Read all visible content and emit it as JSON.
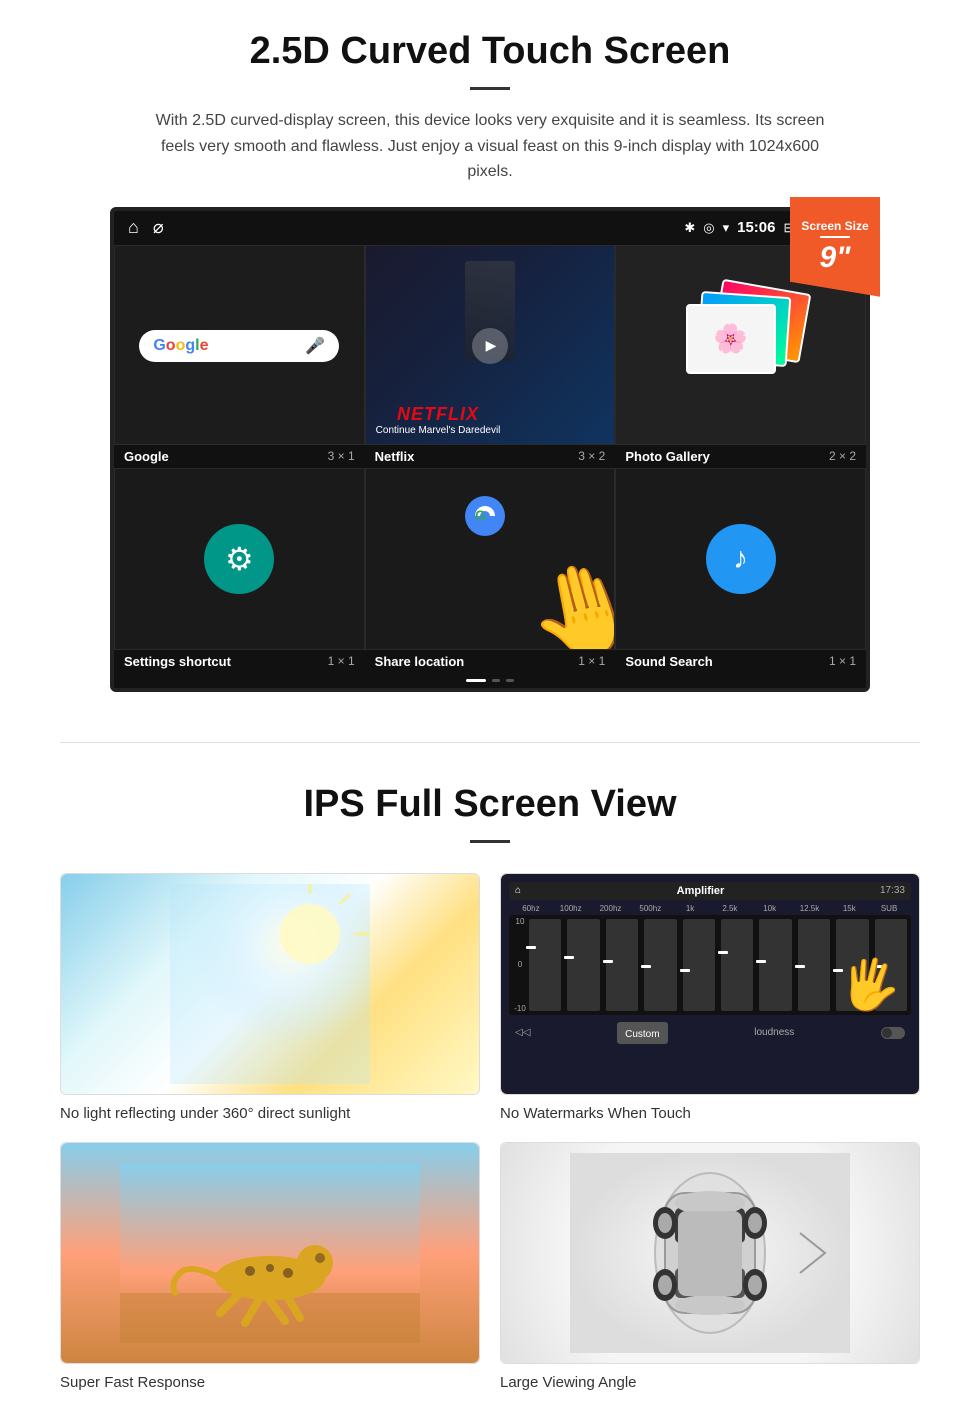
{
  "section1": {
    "title": "2.5D Curved Touch Screen",
    "description": "With 2.5D curved-display screen, this device looks very exquisite and it is seamless. Its screen feels very smooth and flawless. Just enjoy a visual feast on this 9-inch display with 1024x600 pixels.",
    "badge": {
      "label": "Screen Size",
      "size": "9\""
    },
    "statusBar": {
      "time": "15:06"
    },
    "apps": [
      {
        "name": "Google",
        "size": "3 × 1"
      },
      {
        "name": "Netflix",
        "size": "3 × 2",
        "netflix_text": "NETFLIX",
        "netflix_sub": "Continue Marvel's Daredevil"
      },
      {
        "name": "Photo Gallery",
        "size": "2 × 2"
      },
      {
        "name": "Settings shortcut",
        "size": "1 × 1"
      },
      {
        "name": "Share location",
        "size": "1 × 1"
      },
      {
        "name": "Sound Search",
        "size": "1 × 1"
      }
    ]
  },
  "section2": {
    "title": "IPS Full Screen View",
    "images": [
      {
        "caption": "No light reflecting under 360° direct sunlight"
      },
      {
        "caption": "No Watermarks When Touch"
      },
      {
        "caption": "Super Fast Response"
      },
      {
        "caption": "Large Viewing Angle"
      }
    ]
  }
}
